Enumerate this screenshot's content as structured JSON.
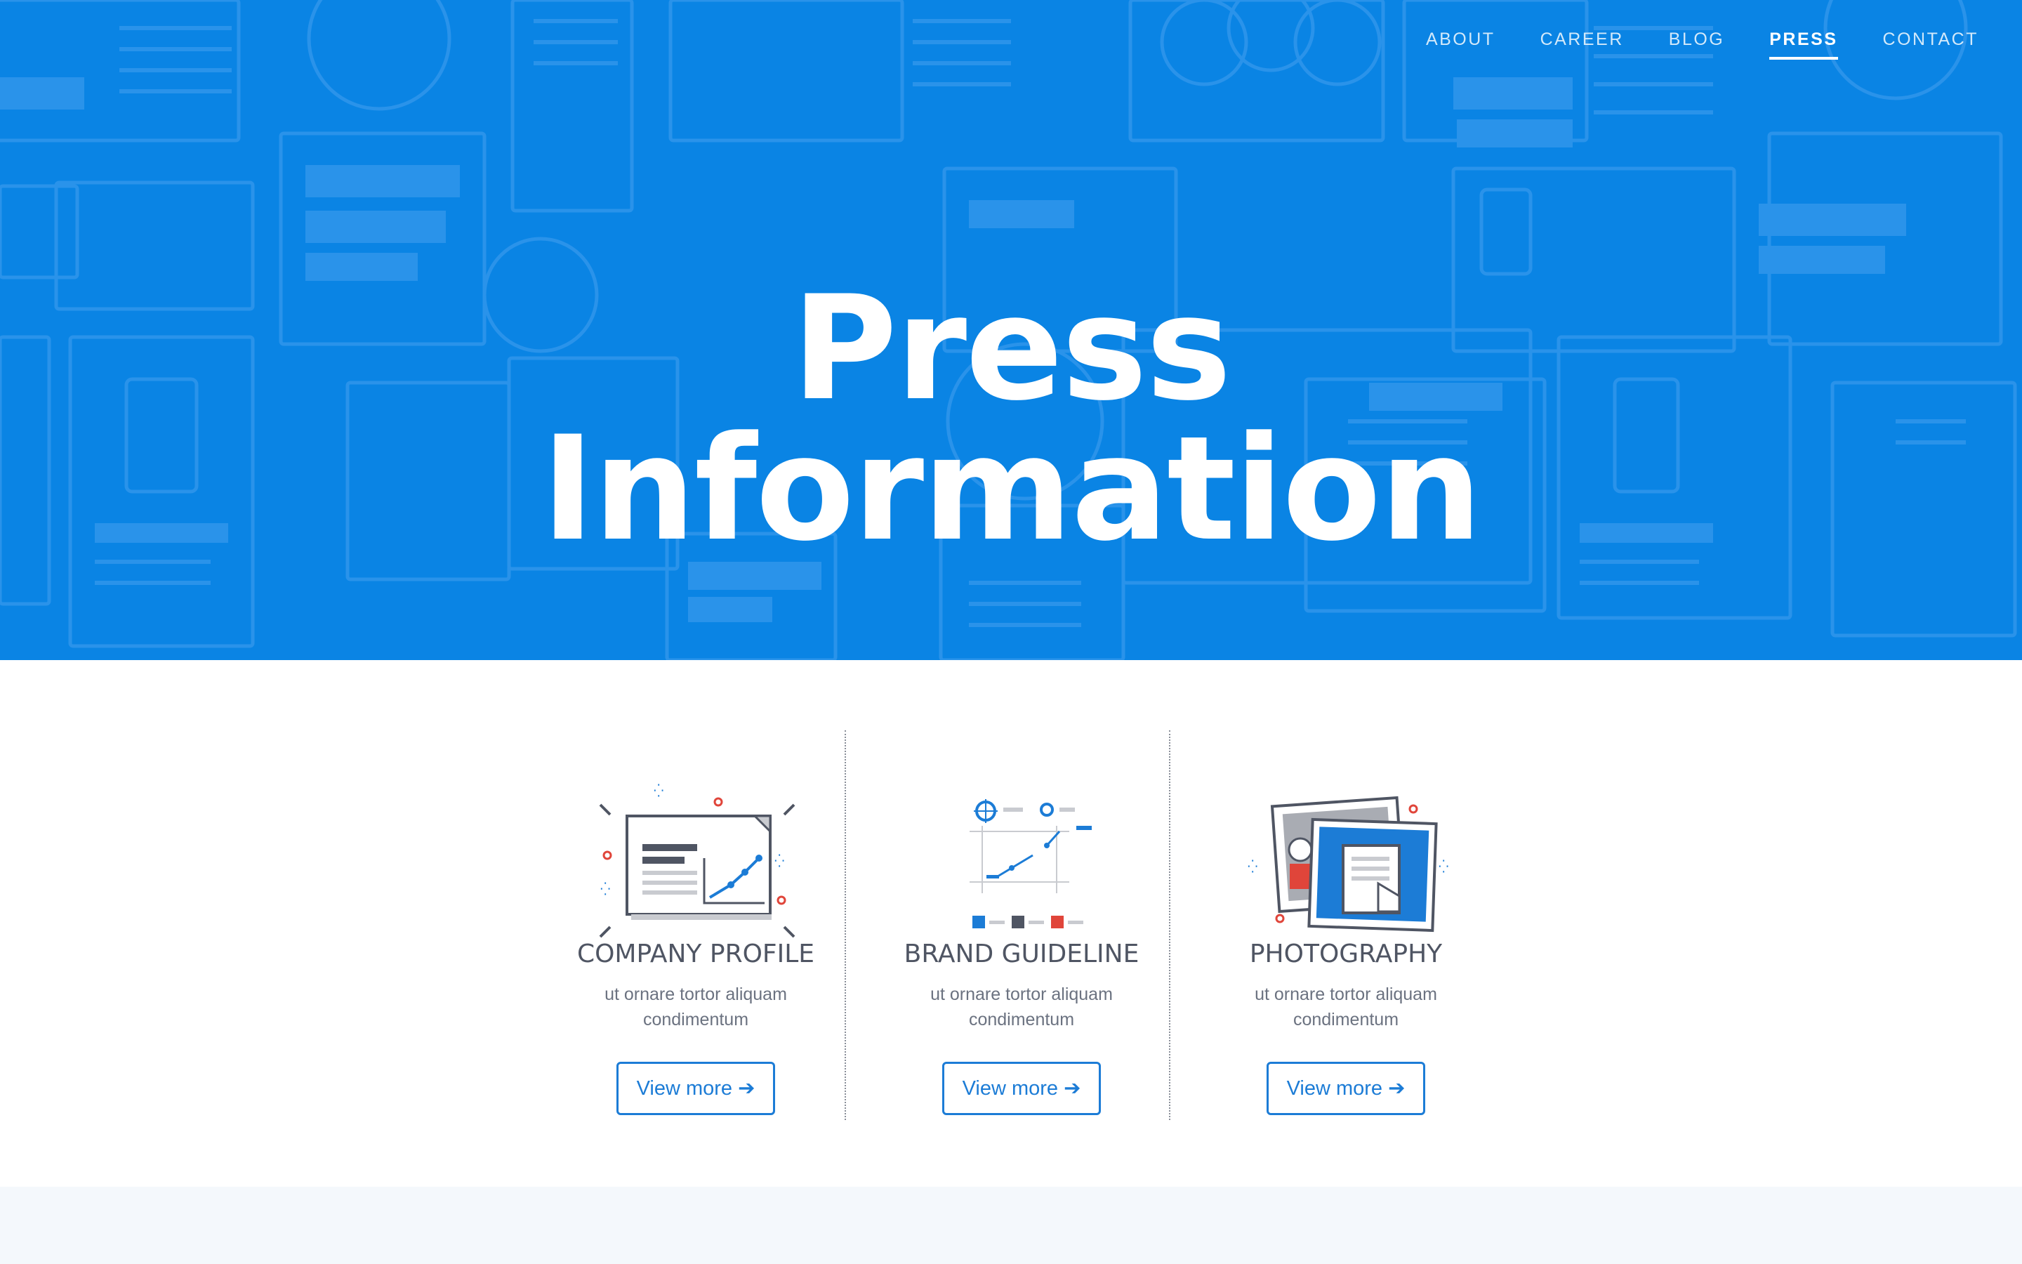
{
  "nav": {
    "items": [
      {
        "label": "ABOUT",
        "active": false
      },
      {
        "label": "CAREER",
        "active": false
      },
      {
        "label": "BLOG",
        "active": false
      },
      {
        "label": "PRESS",
        "active": true
      },
      {
        "label": "CONTACT",
        "active": false
      }
    ]
  },
  "hero": {
    "title_line1": "Press",
    "title_line2": "Information",
    "background_color": "#0a84e4"
  },
  "cards": [
    {
      "title": "COMPANY PROFILE",
      "description": "ut ornare tortor aliquam condimentum",
      "button_label": "View more",
      "button_icon": "arrow-right-icon",
      "illustration": "presentation-chart-icon"
    },
    {
      "title": "BRAND GUIDELINE",
      "description": "ut ornare tortor aliquam condimentum",
      "button_label": "View more",
      "button_icon": "arrow-right-icon",
      "illustration": "brand-grid-icon"
    },
    {
      "title": "PHOTOGRAPHY",
      "description": "ut ornare tortor aliquam condimentum",
      "button_label": "View more",
      "button_icon": "arrow-right-icon",
      "illustration": "photo-frames-icon"
    }
  ],
  "colors": {
    "accent": "#1c7cd6",
    "heading": "#4f5563",
    "body_text": "#6b7280",
    "red": "#e0453a"
  }
}
